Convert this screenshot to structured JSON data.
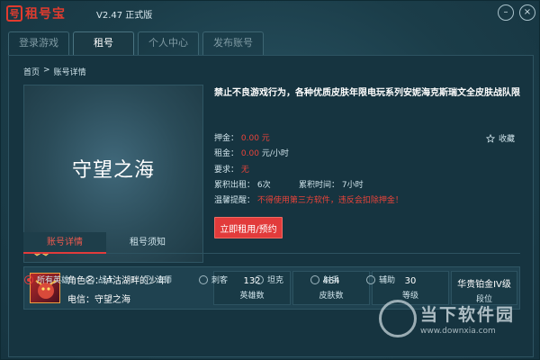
{
  "app": {
    "logo_glyph": "号",
    "logo_text": "租号宝",
    "version": "V2.47 正式版",
    "brand_color": "#e23b2e"
  },
  "window_controls": {
    "minimize": "–",
    "close": "×"
  },
  "tabs": [
    {
      "label": "登录游戏",
      "active": false
    },
    {
      "label": "租号",
      "active": true
    },
    {
      "label": "个人中心",
      "active": false
    },
    {
      "label": "发布账号",
      "active": false
    }
  ],
  "breadcrumb": {
    "home": "首页",
    "sep": ">",
    "current": "账号详情"
  },
  "hero": {
    "title": "守望之海"
  },
  "listing": {
    "headline": "禁止不良游戏行为，各种优质皮肤年限电玩系列安妮海克斯瑞文全皮肤战队限定…",
    "deposit_label": "押金：",
    "deposit_value": "0.00 元",
    "rent_label": "租金：",
    "rent_value": "0.00",
    "rent_unit": "元/小时",
    "requirement_label": "要求：",
    "requirement_value": "无",
    "total_rented_label": "累积出租：",
    "total_rented_value": "6次",
    "total_time_label": "累积时间：",
    "total_time_value": "7小时",
    "warning_label": "温馨提醒：",
    "warning_text": "不得使用第三方软件，违反会扣除押金！",
    "favorite_label": "收藏",
    "rent_button": "立即租用/预约"
  },
  "detail_tabs": [
    {
      "label": "账号详情",
      "active": true
    },
    {
      "label": "租号须知",
      "active": false
    }
  ],
  "character": {
    "name_label": "角色名：",
    "name_value": "泸沽湖畔的少年i",
    "server_label": "电信：",
    "server_value": "守望之海"
  },
  "stats": [
    {
      "value": "132",
      "label": "英雄数"
    },
    {
      "value": "464",
      "label": "皮肤数"
    },
    {
      "value": "30",
      "label": "等级"
    },
    {
      "value": "华贵铂金IV级",
      "label": "段位"
    }
  ],
  "filters": [
    {
      "label": "所有英雄",
      "selected": true
    },
    {
      "label": "战士",
      "selected": false
    },
    {
      "label": "法师",
      "selected": false
    },
    {
      "label": "刺客",
      "selected": false
    },
    {
      "label": "坦克",
      "selected": false
    },
    {
      "label": "射手",
      "selected": false
    },
    {
      "label": "辅助",
      "selected": false
    }
  ],
  "watermark": {
    "text": "当下软件园",
    "url": "www.downxia.com"
  }
}
